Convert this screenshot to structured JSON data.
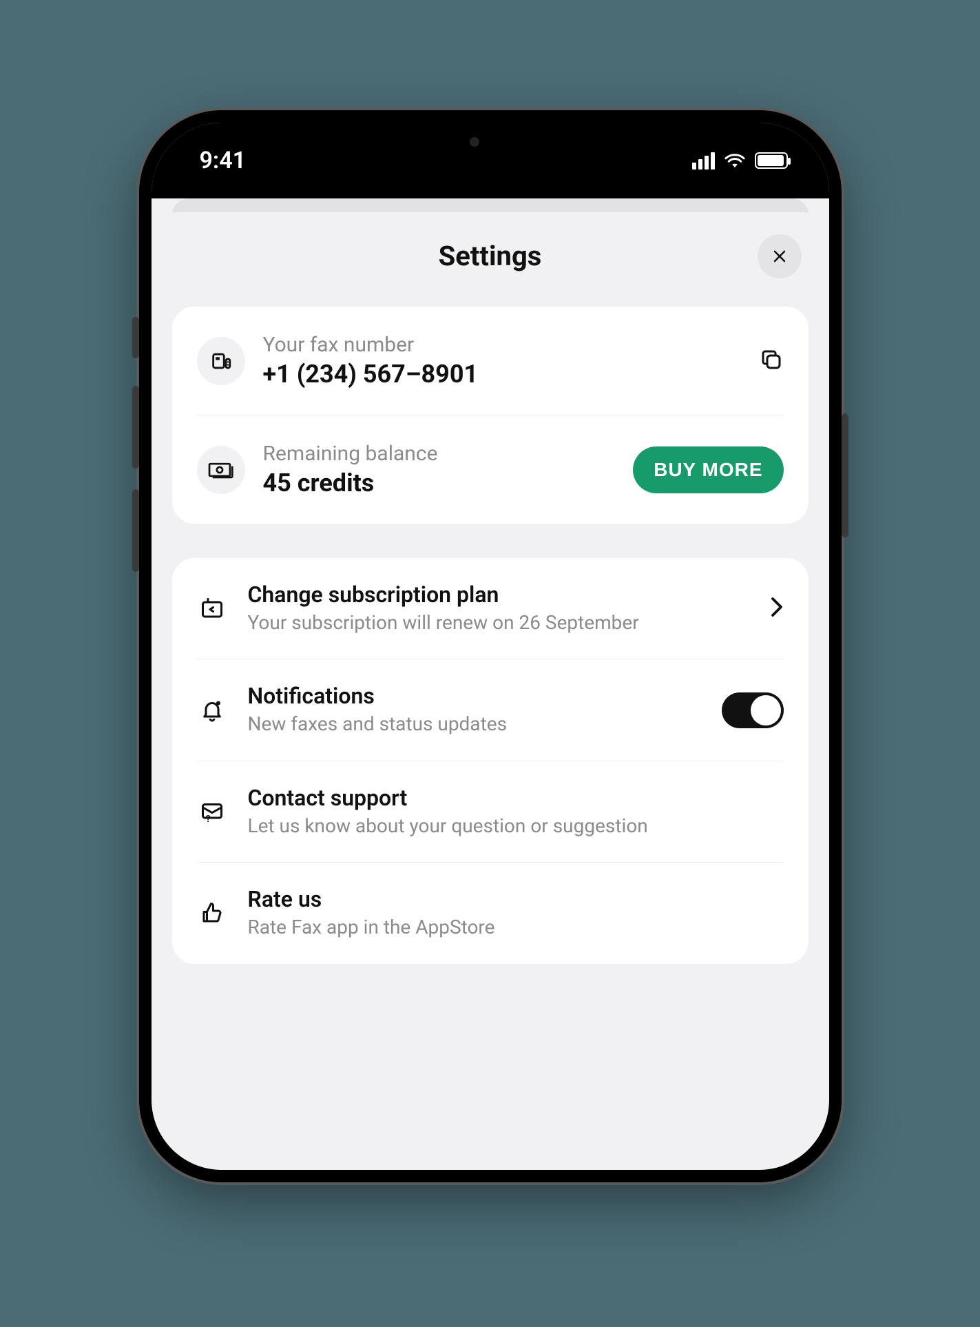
{
  "statusBar": {
    "time": "9:41"
  },
  "header": {
    "title": "Settings"
  },
  "account": {
    "faxLabel": "Your fax number",
    "faxValue": "+1 (234) 567–8901",
    "balanceLabel": "Remaining balance",
    "balanceValue": "45 credits",
    "buyLabel": "BUY MORE"
  },
  "rows": {
    "subscription": {
      "title": "Change subscription plan",
      "sub": "Your subscription will renew on 26 September"
    },
    "notifications": {
      "title": "Notifications",
      "sub": "New faxes and status updates",
      "enabled": true
    },
    "support": {
      "title": "Contact support",
      "sub": "Let us know about your question or suggestion"
    },
    "rate": {
      "title": "Rate us",
      "sub": "Rate Fax app in the AppStore"
    }
  }
}
